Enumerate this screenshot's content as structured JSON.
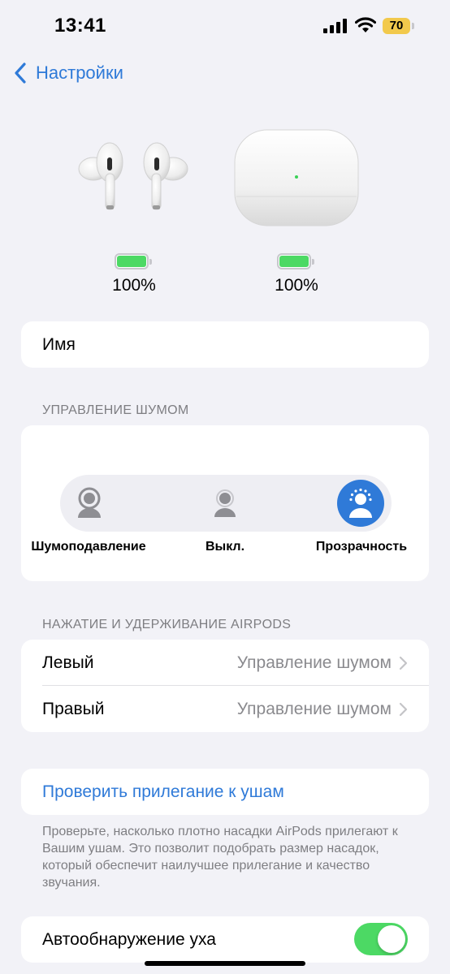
{
  "status_bar": {
    "time": "13:41",
    "battery_level": "70",
    "battery_color": "#f2c94c"
  },
  "nav": {
    "back_label": "Настройки"
  },
  "devices": {
    "buds_battery": "100%",
    "case_battery": "100%"
  },
  "name_row": {
    "label": "Имя"
  },
  "noise_control": {
    "header": "УПРАВЛЕНИЕ ШУМОМ",
    "options": [
      {
        "label": "Шумоподавление",
        "icon": "noise-cancellation-icon",
        "selected": false
      },
      {
        "label": "Выкл.",
        "icon": "person-off-icon",
        "selected": false
      },
      {
        "label": "Прозрачность",
        "icon": "transparency-icon",
        "selected": true
      }
    ]
  },
  "press_hold": {
    "header": "НАЖАТИЕ И УДЕРЖИВАНИЕ AIRPODS",
    "rows": [
      {
        "label": "Левый",
        "value": "Управление шумом"
      },
      {
        "label": "Правый",
        "value": "Управление шумом"
      }
    ]
  },
  "ear_fit": {
    "link": "Проверить прилегание к ушам",
    "footnote": "Проверьте, насколько плотно насадки AirPods прилегают к Вашим ушам. Это позволит подобрать размер насадок, который обеспечит наилучшее прилегание и качество звучания."
  },
  "ear_detection": {
    "label": "Автообнаружение уха",
    "enabled": true
  },
  "colors": {
    "accent": "#2f7ad8",
    "toggle_on": "#4cd964",
    "background": "#f2f2f7"
  }
}
